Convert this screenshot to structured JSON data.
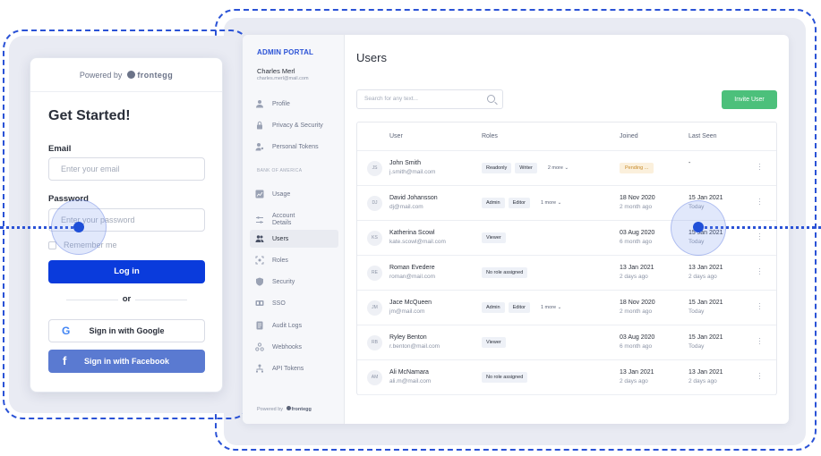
{
  "admin": {
    "portal_title": "ADMIN PORTAL",
    "user_name": "Charles Merl",
    "user_email": "charles.merl@mail.com",
    "nav_top": [
      {
        "label": "Profile",
        "icon": "person-icon"
      },
      {
        "label": "Privacy & Security",
        "icon": "lock-icon"
      },
      {
        "label": "Personal Tokens",
        "icon": "person-key-icon"
      }
    ],
    "section_label": "BANK OF AMERICA",
    "nav_bottom": [
      {
        "label": "Usage",
        "icon": "chart-icon"
      },
      {
        "label": "Account Details",
        "icon": "sliders-icon"
      },
      {
        "label": "Users",
        "icon": "users-icon",
        "active": true
      },
      {
        "label": "Roles",
        "icon": "roles-icon"
      },
      {
        "label": "Security",
        "icon": "shield-icon"
      },
      {
        "label": "SSO",
        "icon": "sso-icon"
      },
      {
        "label": "Audit Logs",
        "icon": "doc-icon"
      },
      {
        "label": "Webhooks",
        "icon": "webhook-icon"
      },
      {
        "label": "API Tokens",
        "icon": "api-icon"
      }
    ],
    "powered_prefix": "Powered by",
    "powered_brand": "frontegg",
    "page_title": "Users",
    "search_placeholder": "Search for any text...",
    "invite_label": "Invite User",
    "columns": {
      "user": "User",
      "roles": "Roles",
      "joined": "Joined",
      "last_seen": "Last Seen"
    },
    "rows": [
      {
        "initials": "JS",
        "name": "John Smith",
        "email": "j.smith@mail.com",
        "roles": [
          "Readonly",
          "Writer"
        ],
        "more": "2 more",
        "joined": "",
        "joined_sub": "",
        "pending": "Pending ...",
        "last": "-",
        "last_sub": ""
      },
      {
        "initials": "DJ",
        "name": "David Johansson",
        "email": "dj@mail.com",
        "roles": [
          "Admin",
          "Editor"
        ],
        "more": "1 more",
        "joined": "18 Nov 2020",
        "joined_sub": "2 month ago",
        "pending": "",
        "last": "15 Jan 2021",
        "last_sub": "Today"
      },
      {
        "initials": "KS",
        "name": "Katherina Scowl",
        "email": "kate.scowl@mail.com",
        "roles": [
          "Viewer"
        ],
        "more": "",
        "joined": "03 Aug 2020",
        "joined_sub": "6 month ago",
        "pending": "",
        "last": "15 Jan 2021",
        "last_sub": "Today"
      },
      {
        "initials": "RE",
        "name": "Roman Evedere",
        "email": "roman@mail.com",
        "roles": [
          "No role assigned"
        ],
        "more": "",
        "joined": "13 Jan 2021",
        "joined_sub": "2 days ago",
        "pending": "",
        "last": "13 Jan 2021",
        "last_sub": "2 days ago"
      },
      {
        "initials": "JM",
        "name": "Jace McQueen",
        "email": "jm@mail.com",
        "roles": [
          "Admin",
          "Editor"
        ],
        "more": "1 more",
        "joined": "18 Nov 2020",
        "joined_sub": "2 month ago",
        "pending": "",
        "last": "15 Jan 2021",
        "last_sub": "Today"
      },
      {
        "initials": "RB",
        "name": "Ryley Benton",
        "email": "r.benton@mail.com",
        "roles": [
          "Viewer"
        ],
        "more": "",
        "joined": "03 Aug 2020",
        "joined_sub": "6 month ago",
        "pending": "",
        "last": "15 Jan 2021",
        "last_sub": "Today"
      },
      {
        "initials": "AM",
        "name": "Ali McNamara",
        "email": "ali.m@mail.com",
        "roles": [
          "No role assigned"
        ],
        "more": "",
        "joined": "13 Jan 2021",
        "joined_sub": "2 days ago",
        "pending": "",
        "last": "13 Jan 2021",
        "last_sub": "2 days ago"
      }
    ]
  },
  "login": {
    "powered_prefix": "Powered by",
    "brand": "frontegg",
    "heading": "Get Started!",
    "email_label": "Email",
    "email_placeholder": "Enter your email",
    "password_label": "Password",
    "password_placeholder": "Enter your password",
    "remember_label": "Remember me",
    "login_button": "Log in",
    "or_label": "or",
    "google_button": "Sign in with Google",
    "facebook_button": "Sign in with Facebook"
  },
  "colors": {
    "accent": "#2a52d6",
    "primary_button": "#0a3bdc",
    "invite": "#4cc07b",
    "facebook": "#5a7ad1"
  }
}
